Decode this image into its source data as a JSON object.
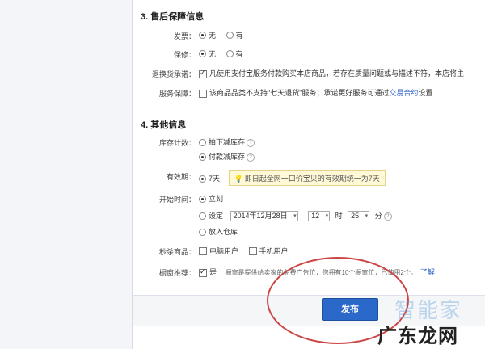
{
  "section3": {
    "title": "3. 售后保障信息",
    "invoice": {
      "label": "发票：",
      "opt_none": "无",
      "opt_yes": "有"
    },
    "warranty": {
      "label": "保修：",
      "opt_none": "无",
      "opt_yes": "有"
    },
    "return": {
      "label": "退换货承诺：",
      "text": "凡使用支付宝服务付款购买本店商品，若存在质量问题或与描述不符，本店将主"
    },
    "service": {
      "label": "服务保障：",
      "text": "该商品品类不支持\"七天退货\"服务；承诺更好服务可通过",
      "link": "交易合约",
      "suffix": "设置"
    }
  },
  "section4": {
    "title": "4. 其他信息",
    "stock": {
      "label": "库存计数：",
      "opt_order": "拍下减库存",
      "opt_pay": "付款减库存"
    },
    "validity": {
      "label": "有效期：",
      "value": "7天",
      "hint": "即日起全网一口价宝贝的有效期统一为7天"
    },
    "start": {
      "label": "开始时间：",
      "opt_now": "立刻",
      "opt_set": "设定",
      "date": "2014年12月28日",
      "hour": "12",
      "hour_unit": "时",
      "minute": "25",
      "minute_unit": "分",
      "opt_warehouse": "放入仓库"
    },
    "seckill": {
      "label": "秒杀商品：",
      "opt_pc": "电脑用户",
      "opt_mobile": "手机用户"
    },
    "recommend": {
      "label": "橱窗推荐：",
      "value": "是",
      "text": "橱窗是提供给卖家的免费广告位，您拥有10个橱窗位，已使用2个。",
      "link": "了解"
    }
  },
  "footer": {
    "publish_label": "发布"
  },
  "watermark": {
    "top": "智能家",
    "bottom": "广东龙网"
  },
  "colors": {
    "accent": "#2a69c9",
    "highlight_ring": "#cc4444",
    "hint_bg": "#fff9d6"
  }
}
